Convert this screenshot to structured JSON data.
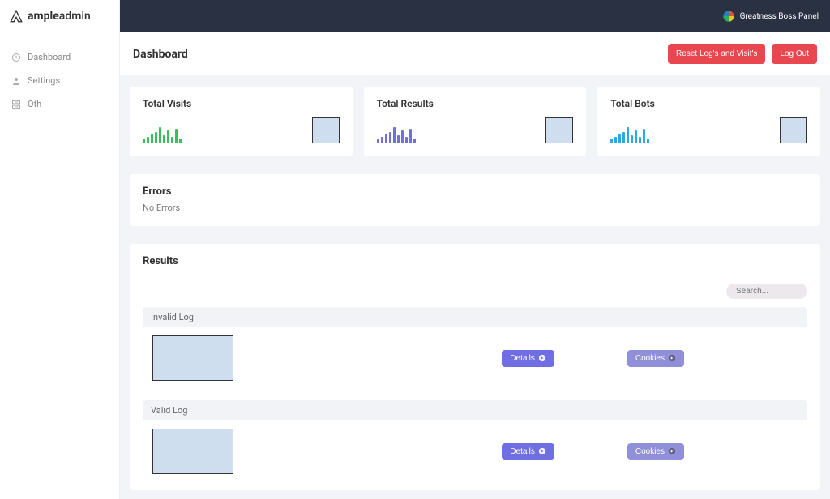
{
  "brand": {
    "name_bold": "ample",
    "name_light": "admin"
  },
  "topbar": {
    "panel_label": "Greatness Boss Panel"
  },
  "sidebar": {
    "items": [
      {
        "label": "Dashboard",
        "icon": "clock"
      },
      {
        "label": "Settings",
        "icon": "user"
      },
      {
        "label": "Oth",
        "icon": "grid"
      }
    ]
  },
  "header": {
    "title": "Dashboard",
    "reset_label": "Reset Log's and Visit's",
    "logout_label": "Log Out"
  },
  "stats": [
    {
      "title": "Total Visits",
      "color": "green"
    },
    {
      "title": "Total Results",
      "color": "purple"
    },
    {
      "title": "Total Bots",
      "color": "blue"
    }
  ],
  "errors": {
    "title": "Errors",
    "body": "No Errors"
  },
  "results": {
    "title": "Results",
    "search_placeholder": "Search...",
    "logs": [
      {
        "label": "Invalid Log",
        "details_btn": "Details",
        "cookies_btn": "Cookies"
      },
      {
        "label": "Valid Log",
        "details_btn": "Details",
        "cookies_btn": "Cookies"
      }
    ]
  },
  "chart_data": [
    {
      "type": "bar",
      "title": "Total Visits",
      "values": [
        6,
        8,
        12,
        14,
        20,
        10,
        16,
        8,
        18,
        6
      ],
      "color": "#36c05a"
    },
    {
      "type": "bar",
      "title": "Total Results",
      "values": [
        6,
        8,
        12,
        14,
        20,
        10,
        16,
        8,
        18,
        6
      ],
      "color": "#6f6ee2"
    },
    {
      "type": "bar",
      "title": "Total Bots",
      "values": [
        6,
        8,
        12,
        14,
        20,
        10,
        16,
        8,
        18,
        6
      ],
      "color": "#2aa9e4"
    }
  ]
}
